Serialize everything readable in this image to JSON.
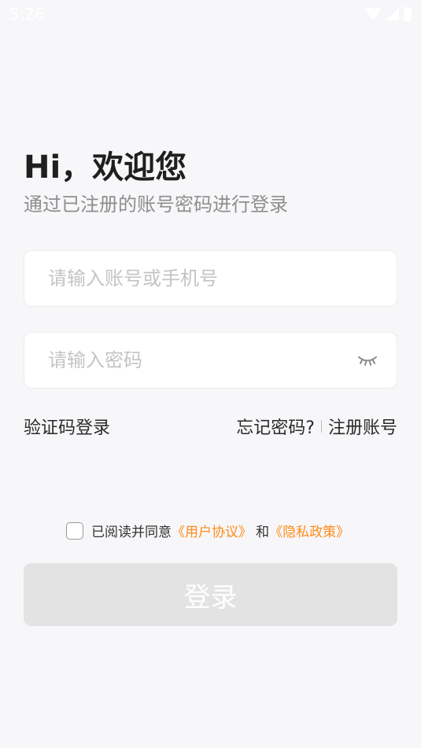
{
  "status_bar": {
    "time": "5:26"
  },
  "header": {
    "title": "Hi，欢迎您",
    "subtitle": "通过已注册的账号密码进行登录"
  },
  "form": {
    "account_placeholder": "请输入账号或手机号",
    "password_placeholder": "请输入密码",
    "password_visibility_icon": "eye-closed-icon"
  },
  "links": {
    "sms_login": "验证码登录",
    "forgot_password": "忘记密码?",
    "register": "注册账号"
  },
  "agreement": {
    "prefix": "已阅读并同意",
    "user_agreement": "《用户协议》",
    "and": "和",
    "privacy_policy": "《隐私政策》"
  },
  "login_button": {
    "label": "登录"
  },
  "colors": {
    "accent": "#ff8c1a",
    "button_disabled": "#e3e3e3"
  }
}
